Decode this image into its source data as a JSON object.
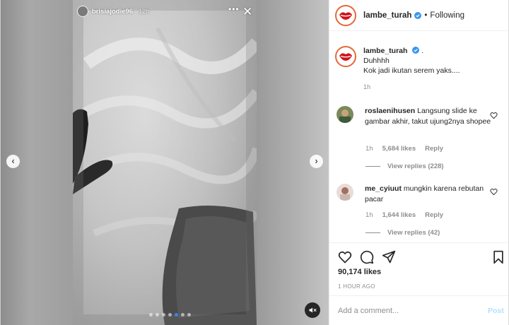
{
  "story": {
    "username": "brisiajodie96",
    "time": "12h",
    "options_glyph": "•••",
    "close_glyph": "✕",
    "dots_total": 7,
    "dots_active_index": 4
  },
  "nav": {
    "prev_glyph": "‹",
    "next_glyph": "›"
  },
  "post": {
    "username": "lambe_turah",
    "follow_state": "Following",
    "caption": {
      "username": "lambe_turah",
      "suffix": ".",
      "lines": [
        "Duhhhh",
        "Kok jadi ikutan serem yaks...."
      ],
      "time": "1h"
    },
    "comments": [
      {
        "username": "roslaenihusen",
        "text": "Langsung slide ke gambar akhir, takut ujung2nya shopee",
        "time": "1h",
        "likes": "5,684 likes",
        "reply_label": "Reply",
        "view_replies": "View replies (228)"
      },
      {
        "username": "me_cyiuut",
        "text": "mungkin karena rebutan pacar",
        "time": "1h",
        "likes": "1,644 likes",
        "reply_label": "Reply",
        "view_replies": "View replies (42)"
      }
    ],
    "likes_count": "90,174 likes",
    "posted_ago": "1 HOUR AGO",
    "comment_placeholder": "Add a comment...",
    "post_button": "Post"
  },
  "colors": {
    "verified": "#3897f0",
    "post_button_disabled": "#b2dffc",
    "story_progress_active": "#2d8cf0"
  },
  "icons": [
    "close-icon",
    "chevron-left-icon",
    "chevron-right-icon",
    "mute-icon",
    "verified-icon",
    "heart-icon",
    "comment-icon",
    "share-icon",
    "bookmark-icon"
  ]
}
